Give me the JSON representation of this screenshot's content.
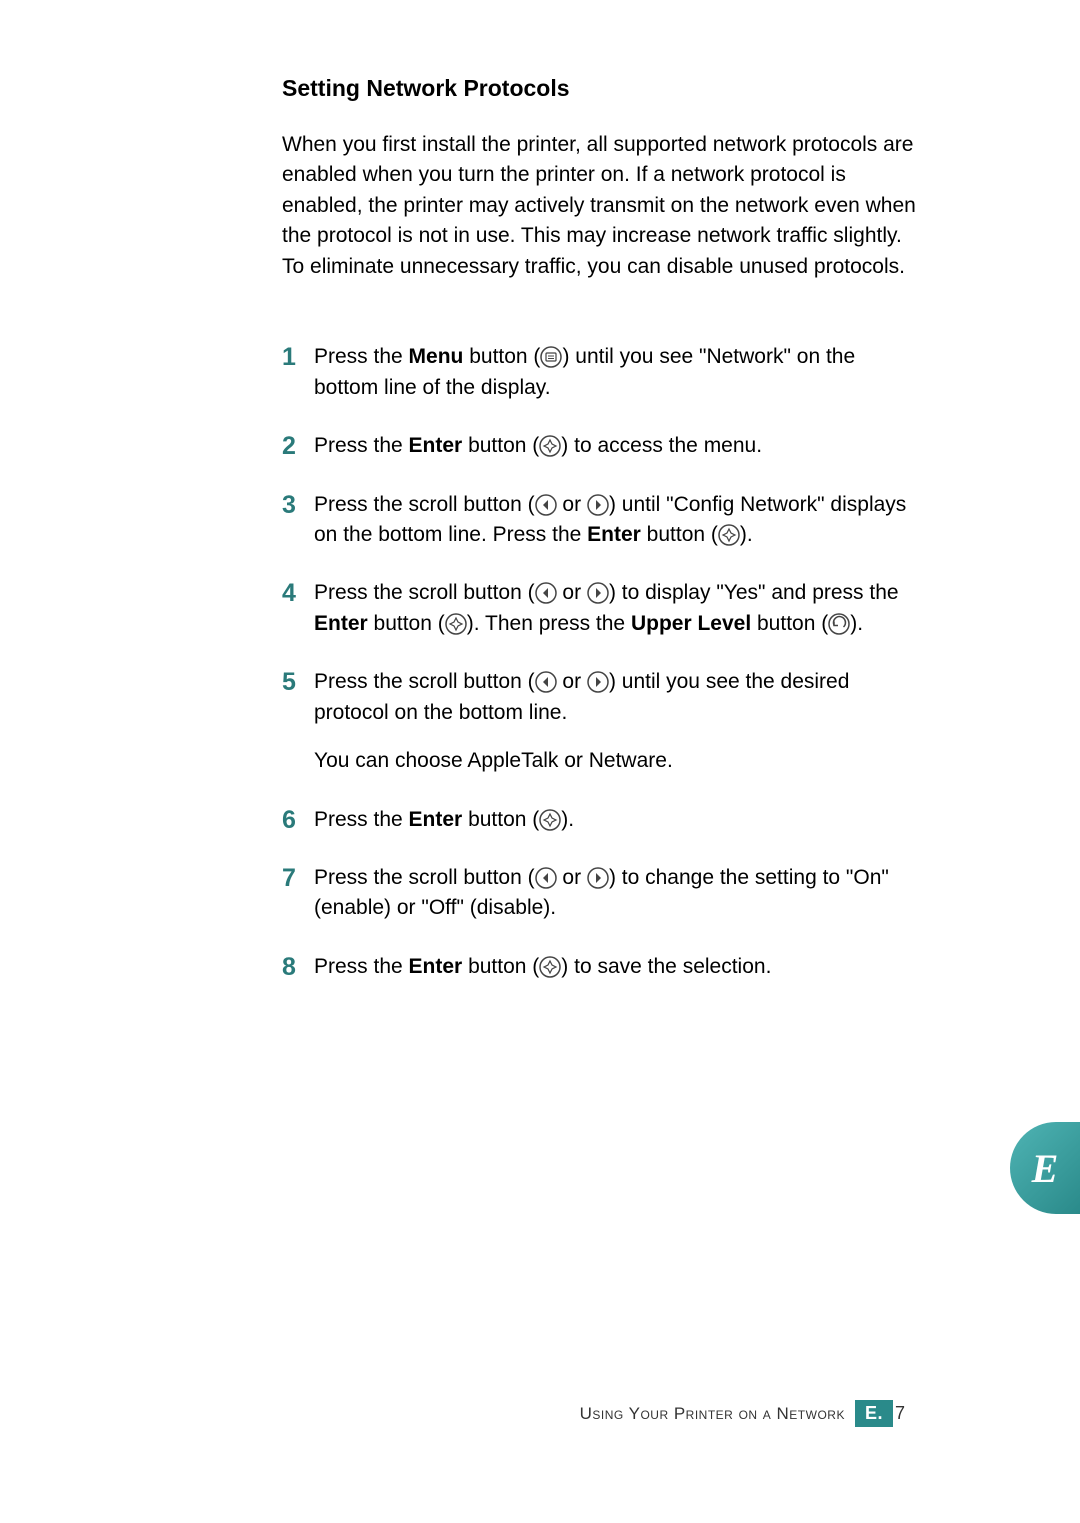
{
  "heading": "Setting Network Protocols",
  "intro": "When you first install the printer, all supported network protocols are enabled when you turn the printer on. If a network protocol is enabled, the printer may actively transmit on the network even when the protocol is not in use. This may increase network traffic slightly. To eliminate unnecessary traffic, you can disable unused protocols.",
  "steps": {
    "1": {
      "pre": "Press the ",
      "b1": "Menu",
      "aft": " button (",
      "post": ") until you see \"Network\" on the bottom line of the display."
    },
    "2": {
      "pre": "Press the ",
      "b1": "Enter",
      "aft": " button (",
      "post": ") to access the menu."
    },
    "3": {
      "pre": "Press the scroll button (",
      "or": " or ",
      "aft": ") until \"Config Network\" displays on the bottom line. Press the ",
      "b1": "Enter",
      "aft2": " button (",
      "post": ")."
    },
    "4": {
      "pre": "Press the scroll button (",
      "or": " or ",
      "aft": ") to display \"Yes\" and press the ",
      "b1": "Enter",
      "aft2": " button (",
      "mid": "). Then press the ",
      "b2": "Upper Level",
      "aft3": " button (",
      "post": ")."
    },
    "5": {
      "pre": "Press the scroll button (",
      "or": " or ",
      "aft": ") until you see the desired protocol on the bottom line.",
      "para2": "You can choose AppleTalk or Netware."
    },
    "6": {
      "pre": "Press the ",
      "b1": "Enter",
      "aft": " button (",
      "post": ")."
    },
    "7": {
      "pre": "Press the scroll button (",
      "or": " or ",
      "aft": ") to change the setting to \"On\" (enable) or \"Off\" (disable)."
    },
    "8": {
      "pre": "Press the ",
      "b1": "Enter",
      "aft": " button (",
      "post": ") to save the selection."
    }
  },
  "footer": {
    "text": "Using Your Printer on a Network",
    "section": "E.",
    "page": "7"
  },
  "corner": {
    "letter": "E"
  }
}
